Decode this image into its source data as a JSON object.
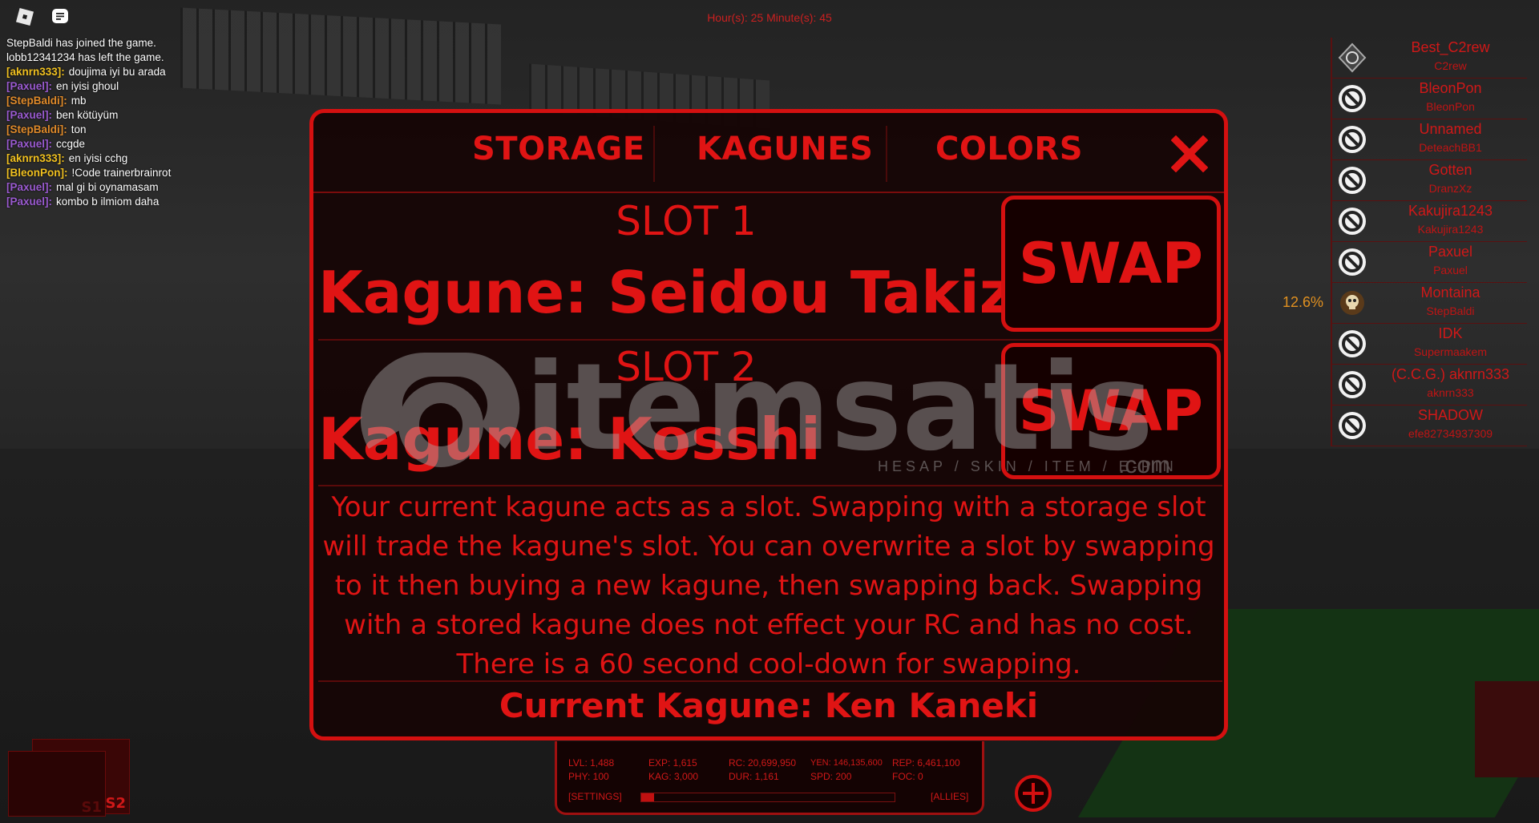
{
  "timer": "Hour(s): 25 Minute(s): 45",
  "chat": [
    {
      "user": "",
      "text": "StepBaldi has joined the game.",
      "color": "#ffffff"
    },
    {
      "user": "",
      "text": "lobb12341234 has left the game.",
      "color": "#ffffff"
    },
    {
      "user": "[aknrn333]:",
      "text": "doujima iyi bu arada",
      "color": "#f0c020"
    },
    {
      "user": "[Paxuel]:",
      "text": "en iyisi ghoul",
      "color": "#9a5ad0"
    },
    {
      "user": "[StepBaldi]:",
      "text": "mb",
      "color": "#e08a2a"
    },
    {
      "user": "[Paxuel]:",
      "text": "ben kötüyüm",
      "color": "#9a5ad0"
    },
    {
      "user": "[StepBaldi]:",
      "text": "ton",
      "color": "#e08a2a"
    },
    {
      "user": "[Paxuel]:",
      "text": "ccgde",
      "color": "#9a5ad0"
    },
    {
      "user": "[aknrn333]:",
      "text": "en iyisi cchg",
      "color": "#f0c020"
    },
    {
      "user": "[BleonPon]:",
      "text": "!Code trainerbrainrot",
      "color": "#f0c020"
    },
    {
      "user": "[Paxuel]:",
      "text": "mal gi bi oynamasam",
      "color": "#9a5ad0"
    },
    {
      "user": "[Paxuel]:",
      "text": "kombo b ilmiom daha",
      "color": "#9a5ad0"
    }
  ],
  "players": [
    {
      "name": "Best_C2rew",
      "sub": "C2rew",
      "icon": "ccg-emblem-icon",
      "pct": ""
    },
    {
      "name": "BleonPon",
      "sub": "BleonPon",
      "icon": "blocked-icon",
      "pct": ""
    },
    {
      "name": "Unnamed",
      "sub": "DeteachBB1",
      "icon": "blocked-icon",
      "pct": ""
    },
    {
      "name": "Gotten",
      "sub": "DranzXz",
      "icon": "blocked-icon",
      "pct": ""
    },
    {
      "name": "Kakujira1243",
      "sub": "Kakujira1243",
      "icon": "blocked-icon",
      "pct": ""
    },
    {
      "name": "Paxuel",
      "sub": "Paxuel",
      "icon": "blocked-icon",
      "pct": ""
    },
    {
      "name": "Montaina",
      "sub": "StepBaldi",
      "icon": "skull-icon",
      "pct": "12.6%"
    },
    {
      "name": "IDK",
      "sub": "Supermaakem",
      "icon": "blocked-icon",
      "pct": ""
    },
    {
      "name": "(C.C.G.) aknrn333",
      "sub": "aknrn333",
      "icon": "blocked-icon",
      "pct": ""
    },
    {
      "name": "SHADOW",
      "sub": "efe82734937309",
      "icon": "blocked-icon",
      "pct": ""
    }
  ],
  "panel": {
    "tabs": {
      "storage": "STORAGE",
      "kagunes": "KAGUNES",
      "colors": "COLORS"
    },
    "slot1": {
      "title": "SLOT 1",
      "kagune": "Kagune: Seidou Takizawa",
      "swap": "SWAP"
    },
    "slot2": {
      "title": "SLOT 2",
      "kagune": "Kagune: Kosshi",
      "swap": "SWAP"
    },
    "description": "Your current kagune acts as a slot. Swapping with a storage slot will trade the kagune's slot. You can overwrite a slot by swapping to it then buying a new kagune, then swapping back. Swapping with a stored kagune does not effect your RC and has no cost. There is a 60 second cool-down for swapping.",
    "current": "Current Kagune: Ken Kaneki"
  },
  "watermark": {
    "brand": "itemsatis",
    "tagline": "HESAP / SKIN / ITEM / E-PIN",
    "com": ".com"
  },
  "stats": {
    "lvl": "LVL: 1,488",
    "exp": "EXP: 1,615",
    "rc": "RC: 20,699,950",
    "yen": "YEN: 146,135,600",
    "rep": "REP: 6,461,100",
    "phy": "PHY: 100",
    "kag": "KAG: 3,000",
    "dur": "DUR: 1,161",
    "spd": "SPD: 200",
    "foc": "FOC: 0",
    "settings": "[SETTINGS]",
    "allies": "[ALLIES]",
    "exp_progress": 0.05
  },
  "slot_boxes": {
    "s1": "S1",
    "s2": "S2"
  },
  "colors": {
    "accent": "#e01414",
    "panel_bg": "#160404",
    "border": "#d41010"
  }
}
